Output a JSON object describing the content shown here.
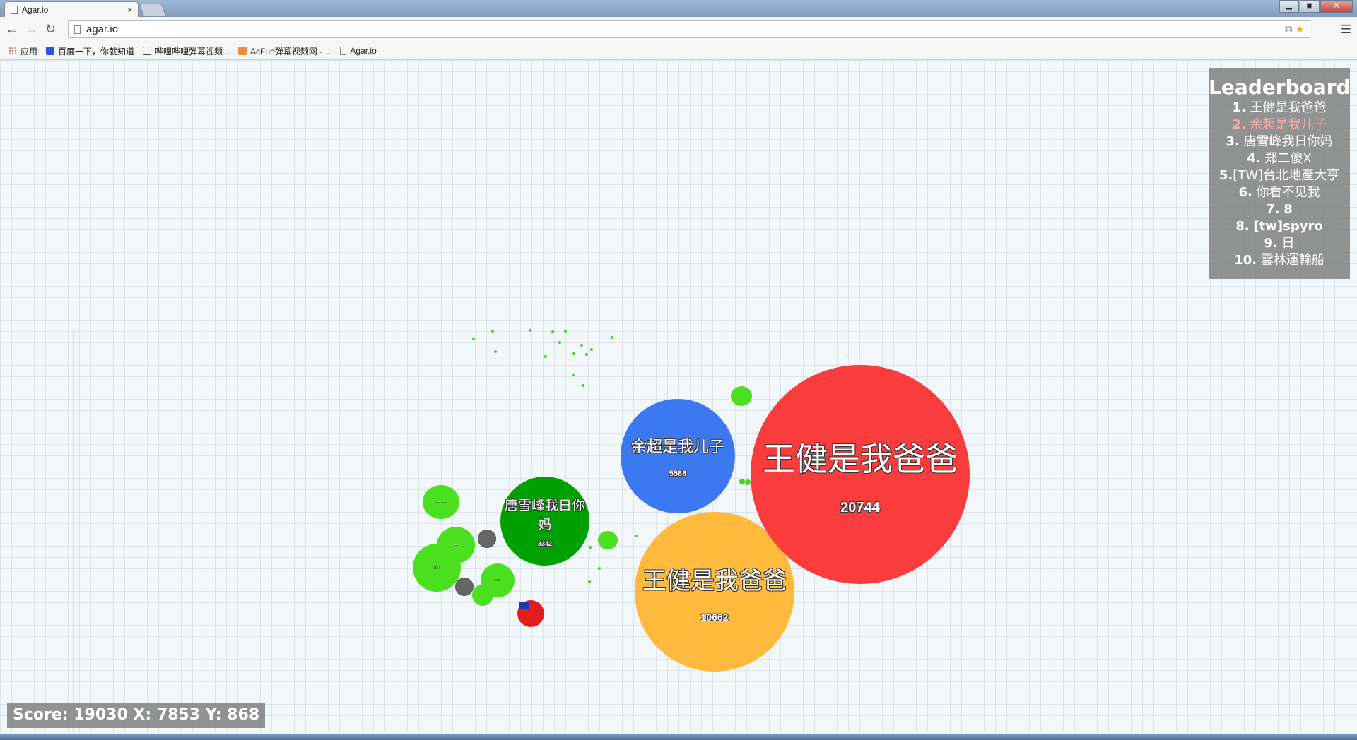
{
  "browser": {
    "tab_title": "Agar.io",
    "tab_close": "×",
    "url": "agar.io",
    "bookmarks": [
      {
        "label": "应用",
        "icon": "apps-icon"
      },
      {
        "label": "百度一下，你就知道",
        "icon": "baidu-icon"
      },
      {
        "label": "哔哩哔哩弹幕视频...",
        "icon": "bilibili-icon"
      },
      {
        "label": "AcFun弹幕视频网 - ...",
        "icon": "acfun-icon"
      },
      {
        "label": "Agar.io",
        "icon": "page-icon"
      }
    ]
  },
  "leaderboard": {
    "title": "Leaderboard",
    "rows": [
      {
        "rank": "1.",
        "name": "王健是我爸爸"
      },
      {
        "rank": "2.",
        "name": "余超是我儿子"
      },
      {
        "rank": "3.",
        "name": "唐雪峰我日你妈"
      },
      {
        "rank": "4.",
        "name": "郑二傻X"
      },
      {
        "rank": "5.",
        "name": "[TW]台北地產大亨"
      },
      {
        "rank": "6.",
        "name": "你看不见我"
      },
      {
        "rank": "7.",
        "name": "8"
      },
      {
        "rank": "8.",
        "name": "[tw]spyro"
      },
      {
        "rank": "9.",
        "name": "日"
      },
      {
        "rank": "10.",
        "name": "雲林運輸船"
      }
    ]
  },
  "cells": {
    "red": {
      "name": "王健是我爸爸",
      "mass": "20744",
      "color": "#fb3c3c"
    },
    "blue": {
      "name": "余超是我儿子",
      "mass": "5588",
      "color": "#3c78f0"
    },
    "orange": {
      "name": "王健是我爸爸",
      "mass": "10662",
      "color": "#ffb93c"
    },
    "green": {
      "name": "唐雪峰我日你妈",
      "mass": "3342",
      "color": "#00a000"
    }
  },
  "hud": {
    "score_text": "Score: 19030 X: 7853 Y: 868"
  }
}
